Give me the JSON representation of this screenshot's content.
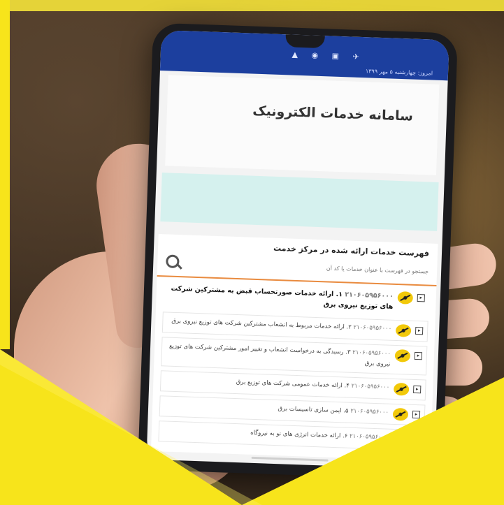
{
  "statusbar": {
    "icons": "▲ ◉ ▣ ✈",
    "date": "امروز: چهارشنبه ۵ مهر ۱۳۹۹"
  },
  "title": "سامانه خدمات الکترونیک",
  "list": {
    "heading": "فهرست خدمات ارائه شده در مرکز خدمت",
    "search_placeholder": "جستجو در فهرست با عنوان خدمات یا کد آن"
  },
  "services": [
    {
      "code": "۲۱۰۶۰۵۹۵۶۰۰۰",
      "text": "۱. ارائه خدمات صورتحساب قبض به مشترکین شرکت های توزیع نیروی برق"
    },
    {
      "code": "۲۱۰۶۰۵۹۵۶۰۰۰",
      "text": "۲. ارائه خدمات مربوط به انشعاب مشترکین شرکت های توزیع نیروی برق"
    },
    {
      "code": "۲۱۰۶۰۵۹۵۶۰۰۰",
      "text": "۳. رسیدگی به درخواست انشعاب و تغییر امور مشترکین شرکت های توزیع نیروی برق"
    },
    {
      "code": "۲۱۰۶۰۵۹۵۶۰۰۰",
      "text": "۴. ارائه خدمات عمومی شرکت های توزیع برق"
    },
    {
      "code": "۲۱۰۶۰۵۹۵۶۰۰۰",
      "text": "۵. ایمن سازی تاسیسات برق"
    },
    {
      "code": "۲۱۰۶۰۵۹۵۶۰۰۰",
      "text": "۶. ارائه خدمات انرژی های نو به نیروگاه"
    }
  ]
}
